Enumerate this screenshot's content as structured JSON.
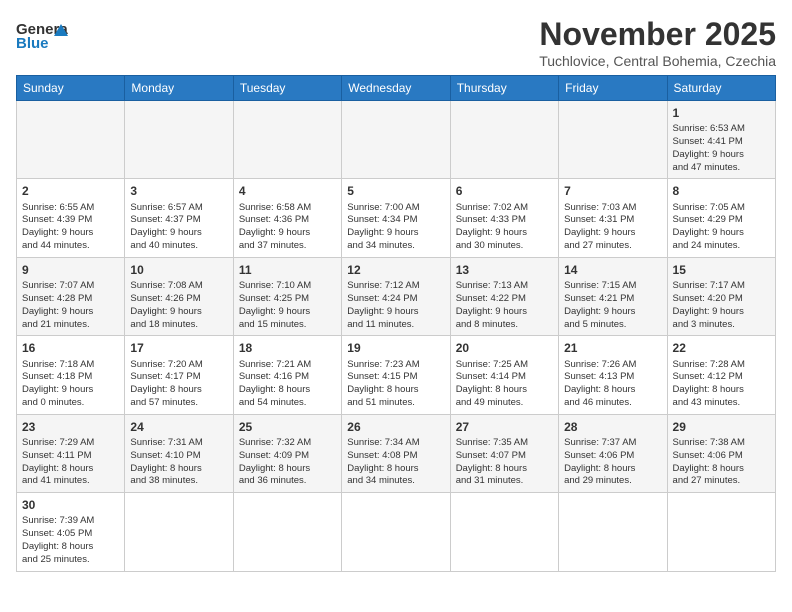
{
  "header": {
    "logo_general": "General",
    "logo_blue": "Blue",
    "title": "November 2025",
    "location": "Tuchlovice, Central Bohemia, Czechia"
  },
  "weekdays": [
    "Sunday",
    "Monday",
    "Tuesday",
    "Wednesday",
    "Thursday",
    "Friday",
    "Saturday"
  ],
  "weeks": [
    [
      {
        "day": "",
        "info": ""
      },
      {
        "day": "",
        "info": ""
      },
      {
        "day": "",
        "info": ""
      },
      {
        "day": "",
        "info": ""
      },
      {
        "day": "",
        "info": ""
      },
      {
        "day": "",
        "info": ""
      },
      {
        "day": "1",
        "info": "Sunrise: 6:53 AM\nSunset: 4:41 PM\nDaylight: 9 hours\nand 47 minutes."
      }
    ],
    [
      {
        "day": "2",
        "info": "Sunrise: 6:55 AM\nSunset: 4:39 PM\nDaylight: 9 hours\nand 44 minutes."
      },
      {
        "day": "3",
        "info": "Sunrise: 6:57 AM\nSunset: 4:37 PM\nDaylight: 9 hours\nand 40 minutes."
      },
      {
        "day": "4",
        "info": "Sunrise: 6:58 AM\nSunset: 4:36 PM\nDaylight: 9 hours\nand 37 minutes."
      },
      {
        "day": "5",
        "info": "Sunrise: 7:00 AM\nSunset: 4:34 PM\nDaylight: 9 hours\nand 34 minutes."
      },
      {
        "day": "6",
        "info": "Sunrise: 7:02 AM\nSunset: 4:33 PM\nDaylight: 9 hours\nand 30 minutes."
      },
      {
        "day": "7",
        "info": "Sunrise: 7:03 AM\nSunset: 4:31 PM\nDaylight: 9 hours\nand 27 minutes."
      },
      {
        "day": "8",
        "info": "Sunrise: 7:05 AM\nSunset: 4:29 PM\nDaylight: 9 hours\nand 24 minutes."
      }
    ],
    [
      {
        "day": "9",
        "info": "Sunrise: 7:07 AM\nSunset: 4:28 PM\nDaylight: 9 hours\nand 21 minutes."
      },
      {
        "day": "10",
        "info": "Sunrise: 7:08 AM\nSunset: 4:26 PM\nDaylight: 9 hours\nand 18 minutes."
      },
      {
        "day": "11",
        "info": "Sunrise: 7:10 AM\nSunset: 4:25 PM\nDaylight: 9 hours\nand 15 minutes."
      },
      {
        "day": "12",
        "info": "Sunrise: 7:12 AM\nSunset: 4:24 PM\nDaylight: 9 hours\nand 11 minutes."
      },
      {
        "day": "13",
        "info": "Sunrise: 7:13 AM\nSunset: 4:22 PM\nDaylight: 9 hours\nand 8 minutes."
      },
      {
        "day": "14",
        "info": "Sunrise: 7:15 AM\nSunset: 4:21 PM\nDaylight: 9 hours\nand 5 minutes."
      },
      {
        "day": "15",
        "info": "Sunrise: 7:17 AM\nSunset: 4:20 PM\nDaylight: 9 hours\nand 3 minutes."
      }
    ],
    [
      {
        "day": "16",
        "info": "Sunrise: 7:18 AM\nSunset: 4:18 PM\nDaylight: 9 hours\nand 0 minutes."
      },
      {
        "day": "17",
        "info": "Sunrise: 7:20 AM\nSunset: 4:17 PM\nDaylight: 8 hours\nand 57 minutes."
      },
      {
        "day": "18",
        "info": "Sunrise: 7:21 AM\nSunset: 4:16 PM\nDaylight: 8 hours\nand 54 minutes."
      },
      {
        "day": "19",
        "info": "Sunrise: 7:23 AM\nSunset: 4:15 PM\nDaylight: 8 hours\nand 51 minutes."
      },
      {
        "day": "20",
        "info": "Sunrise: 7:25 AM\nSunset: 4:14 PM\nDaylight: 8 hours\nand 49 minutes."
      },
      {
        "day": "21",
        "info": "Sunrise: 7:26 AM\nSunset: 4:13 PM\nDaylight: 8 hours\nand 46 minutes."
      },
      {
        "day": "22",
        "info": "Sunrise: 7:28 AM\nSunset: 4:12 PM\nDaylight: 8 hours\nand 43 minutes."
      }
    ],
    [
      {
        "day": "23",
        "info": "Sunrise: 7:29 AM\nSunset: 4:11 PM\nDaylight: 8 hours\nand 41 minutes."
      },
      {
        "day": "24",
        "info": "Sunrise: 7:31 AM\nSunset: 4:10 PM\nDaylight: 8 hours\nand 38 minutes."
      },
      {
        "day": "25",
        "info": "Sunrise: 7:32 AM\nSunset: 4:09 PM\nDaylight: 8 hours\nand 36 minutes."
      },
      {
        "day": "26",
        "info": "Sunrise: 7:34 AM\nSunset: 4:08 PM\nDaylight: 8 hours\nand 34 minutes."
      },
      {
        "day": "27",
        "info": "Sunrise: 7:35 AM\nSunset: 4:07 PM\nDaylight: 8 hours\nand 31 minutes."
      },
      {
        "day": "28",
        "info": "Sunrise: 7:37 AM\nSunset: 4:06 PM\nDaylight: 8 hours\nand 29 minutes."
      },
      {
        "day": "29",
        "info": "Sunrise: 7:38 AM\nSunset: 4:06 PM\nDaylight: 8 hours\nand 27 minutes."
      }
    ],
    [
      {
        "day": "30",
        "info": "Sunrise: 7:39 AM\nSunset: 4:05 PM\nDaylight: 8 hours\nand 25 minutes."
      },
      {
        "day": "",
        "info": ""
      },
      {
        "day": "",
        "info": ""
      },
      {
        "day": "",
        "info": ""
      },
      {
        "day": "",
        "info": ""
      },
      {
        "day": "",
        "info": ""
      },
      {
        "day": "",
        "info": ""
      }
    ]
  ]
}
